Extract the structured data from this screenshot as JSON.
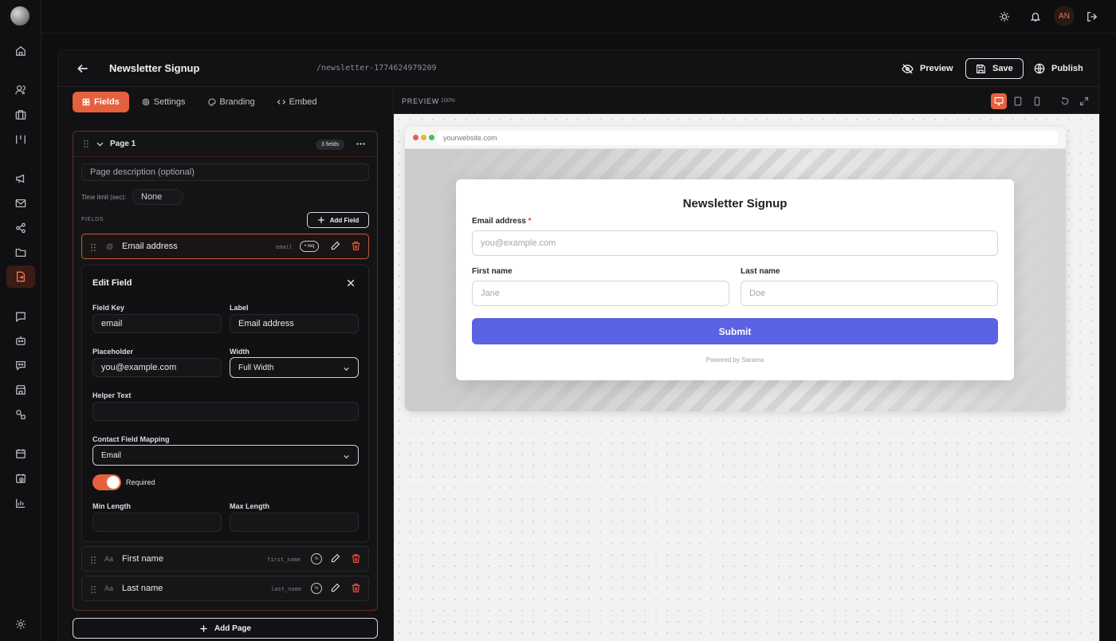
{
  "app": {
    "user_initials": "AN"
  },
  "header": {
    "title": "Newsletter Signup",
    "slug": "/newsletter-1774624979209",
    "preview_label": "Preview",
    "save_label": "Save",
    "publish_label": "Publish"
  },
  "tabs": [
    {
      "label": "Fields",
      "icon": "grid-icon",
      "active": true
    },
    {
      "label": "Settings",
      "icon": "gear-icon",
      "active": false
    },
    {
      "label": "Branding",
      "icon": "palette-icon",
      "active": false
    },
    {
      "label": "Embed",
      "icon": "code-icon",
      "active": false
    }
  ],
  "page": {
    "name": "Page 1",
    "field_count": "3 fields",
    "description_placeholder": "Page description (optional)",
    "time_limit_label": "Time limit (sec):",
    "time_limit_value": "None",
    "fields_heading": "FIELDS",
    "add_field_label": "Add Field"
  },
  "fields": [
    {
      "type_icon": "@",
      "name": "Email address",
      "key": "email",
      "badge": "• req",
      "selected": true
    },
    {
      "type_icon": "Aa",
      "name": "First name",
      "key": "first_name",
      "badge": "½",
      "selected": false
    },
    {
      "type_icon": "Aa",
      "name": "Last name",
      "key": "last_name",
      "badge": "½",
      "selected": false
    }
  ],
  "edit_field": {
    "title": "Edit Field",
    "field_key_label": "Field Key",
    "field_key_value": "email",
    "label_label": "Label",
    "label_value": "Email address",
    "placeholder_label": "Placeholder",
    "placeholder_value": "you@example.com",
    "width_label": "Width",
    "width_value": "Full Width",
    "helper_label": "Helper Text",
    "helper_value": "",
    "mapping_label": "Contact Field Mapping",
    "mapping_value": "Email",
    "required_label": "Required",
    "required_on": true,
    "min_length_label": "Min Length",
    "max_length_label": "Max Length"
  },
  "add_page_label": "Add Page",
  "preview": {
    "label": "PREVIEW",
    "zoom": "100%",
    "url": "yourwebsite.com",
    "form": {
      "title": "Newsletter Signup",
      "email_label": "Email address",
      "email_placeholder": "you@example.com",
      "first_label": "First name",
      "first_placeholder": "Jane",
      "last_label": "Last name",
      "last_placeholder": "Doe",
      "submit": "Submit",
      "powered": "Powered by Sarama"
    }
  },
  "colors": {
    "accent": "#e5603d",
    "submit": "#5b62e3",
    "delete": "#e8503a"
  }
}
